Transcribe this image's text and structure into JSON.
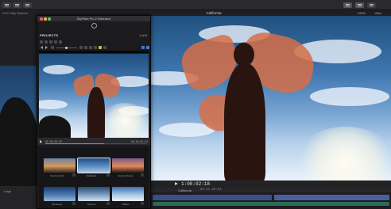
{
  "toolbar": {
    "library_title": "Hi 21 Sky Scenes",
    "viewer_title": "California",
    "zoom_level": "100%",
    "view_label": "View",
    "buttons": [
      "import-icon",
      "keyword-icon",
      "analysis-icon",
      "share-icon"
    ]
  },
  "plugin": {
    "window_title": "SkyPlate Pro 2 Extension",
    "logo_text": "",
    "projects_label": "PROJECTS",
    "page_indicator": "1 of 8",
    "scrub_start": "00:00:00:00",
    "scrub_end": "00:00:03:24",
    "scrub_progress": 0.58,
    "presets": [
      {
        "label": "Sunrise Ibiza",
        "selected": false
      },
      {
        "label": "Redlands",
        "selected": true
      },
      {
        "label": "Sunset Dunes",
        "selected": false
      },
      {
        "label": "Monterey",
        "selected": false
      },
      {
        "label": "Summit",
        "selected": false
      },
      {
        "label": "Malibu",
        "selected": false
      }
    ]
  },
  "viewer": {
    "timecode": "1:00:02:18"
  },
  "timeline": {
    "project_name": "California",
    "duration": "00:01:28:04"
  },
  "sidebar": {
    "tab_label": "Logo"
  },
  "colors": {
    "accent": "#3f7fd8",
    "sky_top": "#20507f",
    "scarf": "#d66e48"
  }
}
